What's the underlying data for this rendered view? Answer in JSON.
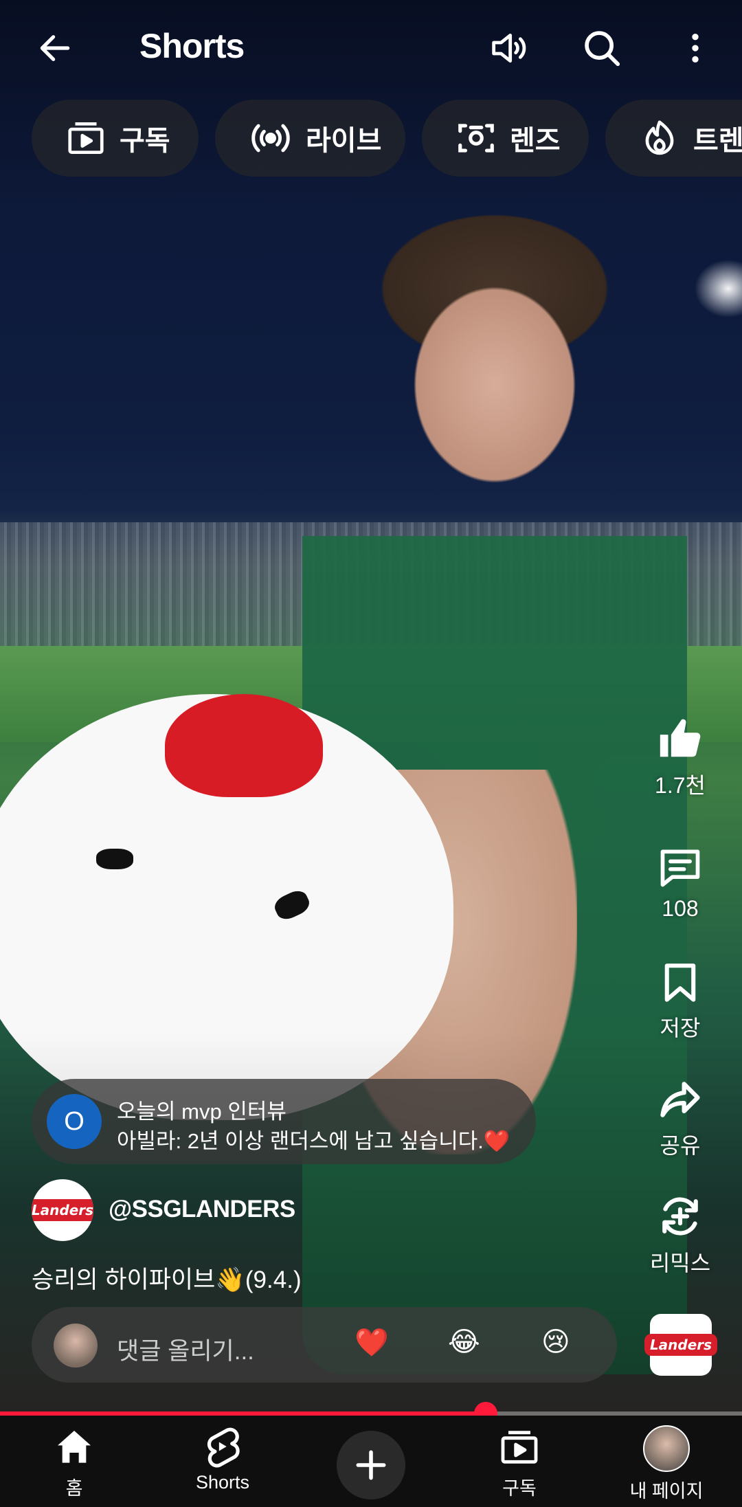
{
  "header": {
    "title": "Shorts"
  },
  "chips": [
    {
      "label": "구독",
      "icon": "subscriptions-icon"
    },
    {
      "label": "라이브",
      "icon": "live-icon"
    },
    {
      "label": "렌즈",
      "icon": "lens-icon"
    },
    {
      "label": "트렌",
      "icon": "trending-icon"
    }
  ],
  "actions": {
    "like": {
      "label": "1.7천",
      "icon": "thumb-up-icon"
    },
    "comment": {
      "label": "108",
      "icon": "comment-icon"
    },
    "save": {
      "label": "저장",
      "icon": "bookmark-icon"
    },
    "share": {
      "label": "공유",
      "icon": "share-icon"
    },
    "remix": {
      "label": "리믹스",
      "icon": "remix-icon"
    }
  },
  "caption": {
    "avatar_letter": "O",
    "line1": "오늘의 mvp 인터뷰",
    "line2": "아빌라: 2년 이상 랜더스에 남고 싶습니다.❤️"
  },
  "channel": {
    "handle": "@SSGLANDERS",
    "logo_text": "Landers"
  },
  "video": {
    "title": "승리의 하이파이브👋(9.4.)"
  },
  "comment_bar": {
    "placeholder": "댓글 올리기...",
    "emojis": [
      "❤️",
      "😂",
      "😢"
    ]
  },
  "progress": {
    "fraction": 0.655,
    "color": "#ff1a3c"
  },
  "bottom_nav": [
    {
      "label": "홈",
      "icon": "home-icon"
    },
    {
      "label": "Shorts",
      "icon": "shorts-icon"
    },
    {
      "label": "",
      "icon": "create-plus-icon"
    },
    {
      "label": "구독",
      "icon": "subscriptions-icon"
    },
    {
      "label": "내 페이지",
      "icon": "profile-avatar"
    }
  ]
}
